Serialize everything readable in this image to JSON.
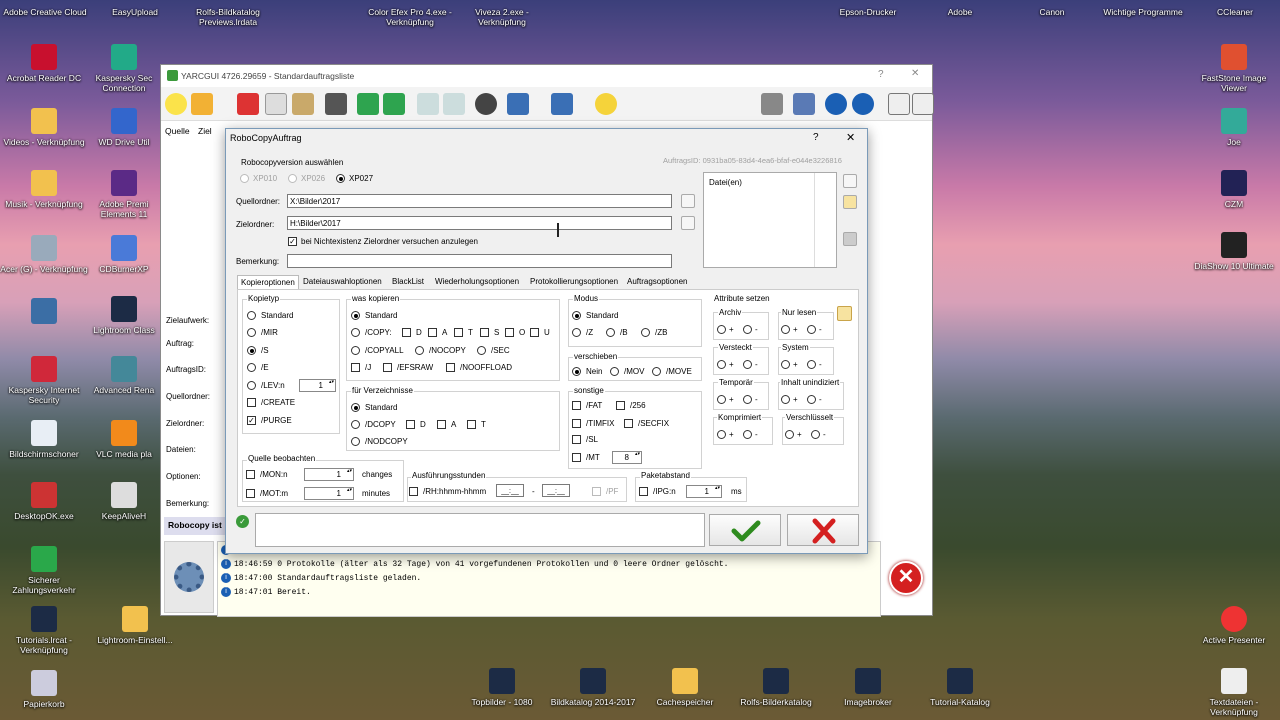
{
  "desktop": {
    "top_labels": [
      "Adobe Creative Cloud",
      "EasyUpload",
      "Rolfs-Bildkatalog Previews.lrdata",
      "Color Efex Pro 4.exe - Verknüpfung",
      "Viveza 2.exe - Verknüpfung",
      "Epson-Drucker",
      "Adobe",
      "Canon",
      "Wichtige Programme",
      "CCleaner"
    ],
    "left_icons": [
      "Acrobat Reader DC",
      "Videos - Verknüpfung",
      "Musik - Verknüpfung",
      "Acer (G) - Verknüpfung",
      "Lightroom Classic",
      "Kaspersky Internet Security",
      "Bildschirmschoner",
      "DesktopOK.exe",
      "Sicherer Zahlungsverkehr",
      "Tutorials.lrcat - Verknüpfung",
      "Papierkorb"
    ],
    "second_icons": [
      "Kaspersky Sec Connection",
      "WD Drive Util",
      "Adobe Premi Elements 11",
      "CDBurnerXP",
      "Lightroom Class",
      "Advanced Rena",
      "VLC media pla",
      "KeepAliveH",
      "Lightroom-Einstell..."
    ],
    "right_icons": [
      "FastStone Image Viewer",
      "Joe",
      "CZM",
      "DiaShow 10 Ultimate",
      "Active Presenter",
      "Textdateien - Verknüpfung"
    ],
    "bottom_icons": [
      "Topbilder - 1080",
      "Bildkatalog 2014-2017",
      "Cachespeicher",
      "Rolfs-Bilderkatalog",
      "Imagebroker",
      "Tutorial-Katalog"
    ]
  },
  "main_window": {
    "title": "YARCGUI 4726.29659 - Standardauftragsliste",
    "help": "?",
    "close": "✕",
    "menu": [
      "Quelle",
      "Ziel"
    ],
    "left_labels": [
      "Zielaufwerk:",
      "Auftrag:",
      "AuftragsID:",
      "Quellordner:",
      "Zielordner:",
      "Dateien:",
      "Optionen:",
      "Bemerkung:"
    ],
    "status_label": "Robocopy ist",
    "log_lines": [
      "18:46:59 0 Protokolle (älter als 32 Tage) von 41 vorgefundenen Protokollen und 0 leere Ordner gelöscht.",
      "18:47:00 Standardauftragsliste geladen.",
      "18:47:01 Bereit."
    ]
  },
  "dialog": {
    "title": "RoboCopyAuftrag",
    "help": "?",
    "close": "✕",
    "version_label": "Robocopyversion auswählen",
    "versions": [
      "XP010",
      "XP026",
      "XP027"
    ],
    "auftrag_id": "AuftragsID: 0931ba05-83d4-4ea6-bfaf-e044e3226816",
    "quellordner_label": "Quellordner:",
    "quellordner_value": "X:\\Bilder\\2017",
    "zielordner_label": "Zielordner:",
    "zielordner_value": "H:\\Bilder\\2017",
    "create_checkbox": "bei Nichtexistenz Zielordner versuchen anzulegen",
    "bemerkung_label": "Bemerkung:",
    "dateien_label": "Datei(en)",
    "tabs": [
      "Kopieroptionen",
      "Dateiauswahloptionen",
      "BlackList",
      "Wiederholungsoptionen",
      "Protokollierungsoptionen",
      "Auftragsoptionen"
    ],
    "kopietyp": {
      "title": "Kopietyp",
      "items": [
        "Standard",
        "/MIR",
        "/S",
        "/E",
        "/LEV:n",
        "/CREATE",
        "/PURGE"
      ],
      "lev_value": "1"
    },
    "was_kopieren": {
      "title": "was kopieren",
      "standard": "Standard",
      "copy": "/COPY:",
      "copy_flags": [
        "D",
        "A",
        "T",
        "S",
        "O",
        "U"
      ],
      "copyall": "/COPYALL",
      "nocopy": "/NOCOPY",
      "sec": "/SEC",
      "j": "/J",
      "efsraw": "/EFSRAW",
      "nooffload": "/NOOFFLOAD"
    },
    "fuer_verzeichnisse": {
      "title": "für Verzeichnisse",
      "standard": "Standard",
      "dcopy": "/DCOPY",
      "flags": [
        "D",
        "A",
        "T"
      ],
      "nodcopy": "/NODCOPY"
    },
    "modus": {
      "title": "Modus",
      "standard": "Standard",
      "items": [
        "/Z",
        "/B",
        "/ZB"
      ]
    },
    "verschieben": {
      "title": "verschieben",
      "items": [
        "Nein",
        "/MOV",
        "/MOVE"
      ]
    },
    "sonstige": {
      "title": "sonstige",
      "fat": "/FAT",
      "s256": "/256",
      "timfix": "/TIMFIX",
      "secfix": "/SECFIX",
      "sl": "/SL",
      "mt": "/MT",
      "mt_value": "8"
    },
    "attribute": {
      "title": "Attribute setzen",
      "groups": [
        "Archiv",
        "Nur lesen",
        "Versteckt",
        "System",
        "Temporär",
        "Inhalt unindiziert",
        "Komprimiert",
        "Verschlüsselt"
      ],
      "plus": "+",
      "minus": "-"
    },
    "quelle_beobachten": {
      "title": "Quelle beobachten",
      "mon": "/MON:n",
      "mon_value": "1",
      "mon_unit": "changes",
      "mot": "/MOT:m",
      "mot_value": "1",
      "mot_unit": "minutes"
    },
    "ausfuehrung": {
      "title": "Ausführungsstunden",
      "rh": "/RH:hhmm-hhmm",
      "from": "__:__",
      "sep": "-",
      "to": "__:__",
      "pf": "/PF"
    },
    "paketabstand": {
      "title": "Paketabstand",
      "ipg": "/IPG:n",
      "value": "1",
      "unit": "ms"
    },
    "ok_color": "#2e8b1e",
    "cancel_color": "#d42020"
  }
}
